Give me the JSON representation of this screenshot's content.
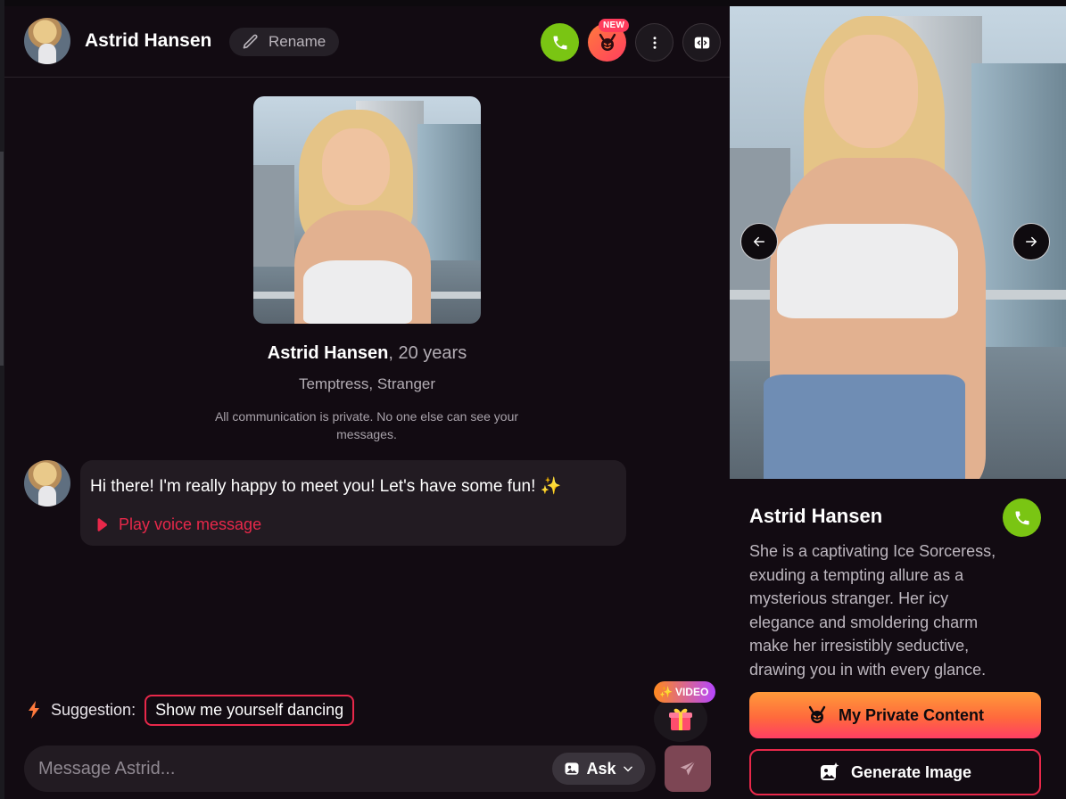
{
  "header": {
    "name": "Astrid Hansen",
    "rename_label": "Rename",
    "new_badge": "NEW"
  },
  "profile": {
    "name": "Astrid Hansen",
    "age": ", 20 years",
    "tags": "Temptress, Stranger",
    "privacy_note": "All communication is private. No one else can see your messages."
  },
  "messages": [
    {
      "text": "Hi there! I'm really happy to meet you! Let's have some fun! ✨",
      "voice_label": "Play voice message"
    }
  ],
  "suggestion": {
    "label": "Suggestion:",
    "text": "Show me yourself dancing"
  },
  "gift": {
    "badge": "VIDEO"
  },
  "composer": {
    "placeholder": "Message Astrid...",
    "ask_label": "Ask"
  },
  "sidebar": {
    "name": "Astrid Hansen",
    "description": "She is a captivating Ice Sorceress, exuding a tempting allure as a mysterious stranger. Her icy elegance and smoldering charm make her irresistibly seductive, drawing you in with every glance.",
    "private_content_label": "My Private Content",
    "generate_image_label": "Generate Image"
  },
  "colors": {
    "accent": "#e8284a",
    "call_green": "#7ac513",
    "background": "#120b12",
    "bubble": "#221b22"
  },
  "icons": {
    "call": "phone-icon",
    "devil": "devil-icon",
    "more": "more-vertical-icon",
    "panel": "panel-toggle-icon",
    "pencil": "pencil-icon",
    "voice": "play-icon",
    "bolt": "bolt-icon",
    "gift": "gift-icon",
    "image": "image-icon",
    "chevron": "chevron-down-icon",
    "send": "send-icon",
    "arrow_left": "arrow-left-icon",
    "arrow_right": "arrow-right-icon",
    "sparkle_image": "image-sparkle-icon"
  }
}
